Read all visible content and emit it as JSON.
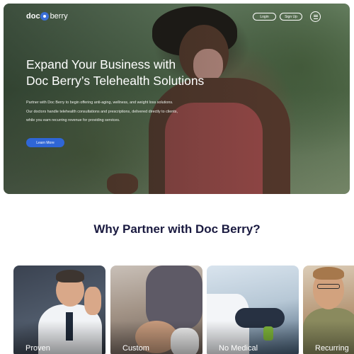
{
  "brand": {
    "logo_part1": "doc",
    "logo_part2": "berry"
  },
  "nav": {
    "login_label": "Login",
    "signup_label": "Sign Up",
    "menu_icon": "hamburger-icon"
  },
  "hero": {
    "title_line1": "Expand Your Business with",
    "title_line2": "Doc Berry’s Telehealth Solutions",
    "desc_line1": "Partner with Doc Berry to begin offering anti-aging, wellness, and weight loss solutions.",
    "desc_line2": "Our doctors handle telehealth consultations and prescriptions, delivered directly to clients,",
    "desc_line3": "while you earn recurring revenue for providing services.",
    "cta_label": "Learn More"
  },
  "why": {
    "title": "Why Partner with Doc Berry?",
    "cards": [
      {
        "label": "Proven"
      },
      {
        "label": "Custom"
      },
      {
        "label": "No Medical"
      },
      {
        "label": "Recurring"
      }
    ]
  },
  "colors": {
    "accent": "#2f66d6",
    "heading": "#1a1a40",
    "logo_mark": "#3b6fd6"
  }
}
